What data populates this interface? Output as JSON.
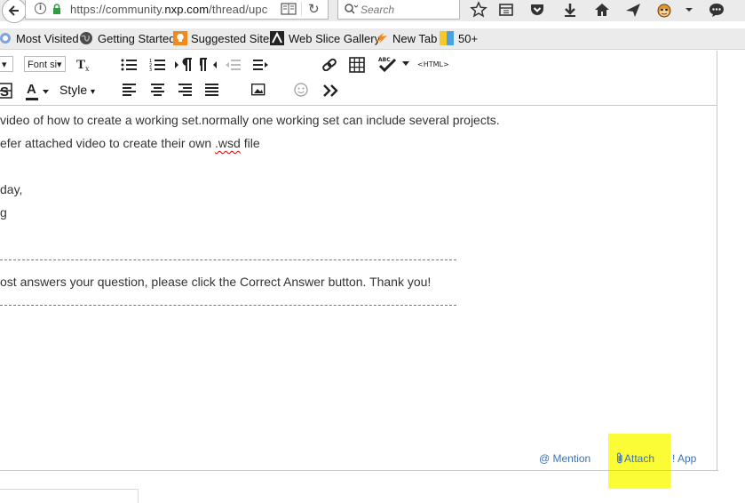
{
  "browser": {
    "url_prefix": "https://community.",
    "url_domain": "nxp.com",
    "url_suffix": "/thread/upc",
    "search_placeholder": "Search"
  },
  "bookmarks": [
    {
      "label": "Most Visited"
    },
    {
      "label": "Getting Started"
    },
    {
      "label": "Suggested Sites"
    },
    {
      "label": "Web Slice Gallery"
    },
    {
      "label": "New Tab"
    },
    {
      "label": "50+"
    }
  ],
  "toolbar": {
    "font_size_label": "Font si",
    "style_label": "Style",
    "html_label": "<HTML>",
    "abc_label": "ABC"
  },
  "content": {
    "line1": "video of how to create a working set.normally one working set can include several projects.",
    "line2_pre": "efer attached video to create their own ",
    "line2_err": ".wsd",
    "line2_post": " file",
    "line3": " day,",
    "line4": "g",
    "line5": "ost answers your question, please click the Correct Answer button. Thank you!"
  },
  "actions": {
    "mention": "@ Mention",
    "attach": "Attach",
    "app": "! App"
  },
  "colors": {
    "link": "#3b73b9",
    "highlight": "#fbfb36"
  }
}
